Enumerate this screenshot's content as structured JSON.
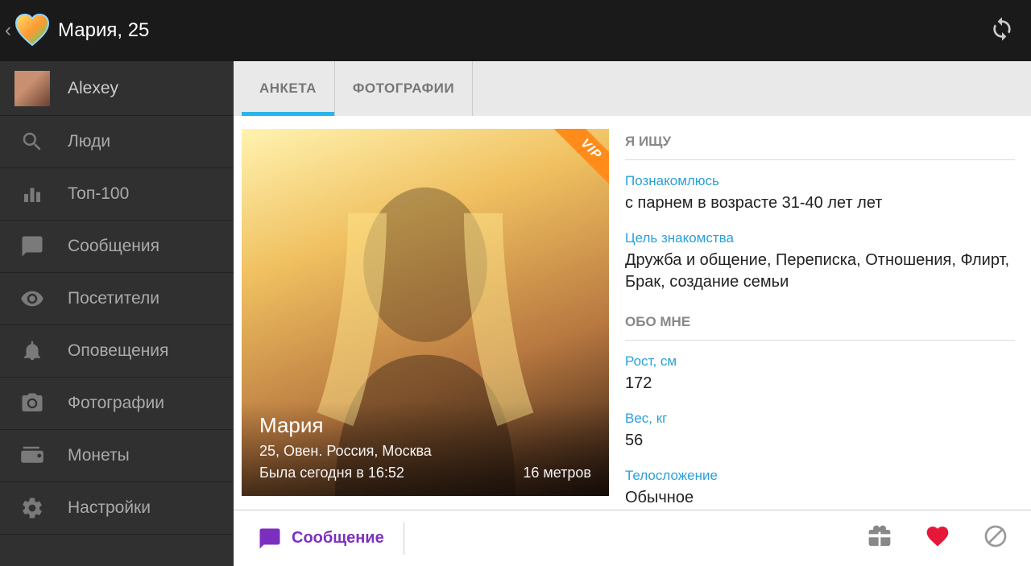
{
  "topbar": {
    "title": "Мария, 25"
  },
  "sidebar": {
    "user_name": "Alexey",
    "items": [
      {
        "label": "Люди"
      },
      {
        "label": "Топ-100"
      },
      {
        "label": "Сообщения"
      },
      {
        "label": "Посетители"
      },
      {
        "label": "Оповещения"
      },
      {
        "label": "Фотографии"
      },
      {
        "label": "Монеты"
      },
      {
        "label": "Настройки"
      }
    ]
  },
  "tabs": {
    "profile": "АНКЕТА",
    "photos": "ФОТОГРАФИИ"
  },
  "photo": {
    "vip": "VIP",
    "name": "Мария",
    "meta": "25, Овен. Россия, Москва",
    "last_seen": "Была сегодня в 16:52",
    "distance": "16 метров"
  },
  "sections": {
    "looking_for_title": "Я ИЩУ",
    "about_me_title": "ОБО МНЕ"
  },
  "looking_for": {
    "meet_label": "Познакомлюсь",
    "meet_value": "с парнем в возрасте 31-40 лет лет",
    "purpose_label": "Цель знакомства",
    "purpose_value": "Дружба и общение, Переписка, Отношения, Флирт, Брак, создание семьи"
  },
  "about": {
    "height_label": "Рост, см",
    "height_value": "172",
    "weight_label": "Вес, кг",
    "weight_value": "56",
    "body_label": "Телосложение",
    "body_value": "Обычное"
  },
  "bottom": {
    "message": "Сообщение"
  }
}
